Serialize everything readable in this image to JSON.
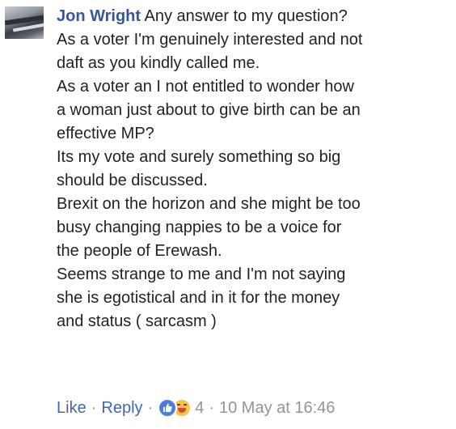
{
  "comment": {
    "author": "Jon Wright",
    "lines": [
      "Any answer to my question?",
      "As a voter I'm genuinely interested and not",
      "daft as you kindly called me.",
      "As a voter an I not entitled to wonder how",
      "a woman just about to give birth can be an",
      "effective MP?",
      "Its my vote and surely something so big",
      "should be discussed.",
      "Brexit on the horizon and she might be too",
      "busy changing nappies to be a voice for",
      "the people of Erewash.",
      "Seems strange to me and I'm not saying",
      "she is egotistical and in it for the money",
      "and status ( sarcasm )"
    ]
  },
  "footer": {
    "like_label": "Like",
    "reply_label": "Reply",
    "separator": "·",
    "reaction_count": "4",
    "timestamp": "10 May at 16:46",
    "reaction_icons": [
      "like-reaction-icon",
      "haha-reaction-icon"
    ]
  },
  "colors": {
    "author": "#365899",
    "link": "#4267b2",
    "meta": "#90949c",
    "text": "#1d2129",
    "like_reaction": "#4a7ce2",
    "haha_reaction": "#f6c443"
  }
}
